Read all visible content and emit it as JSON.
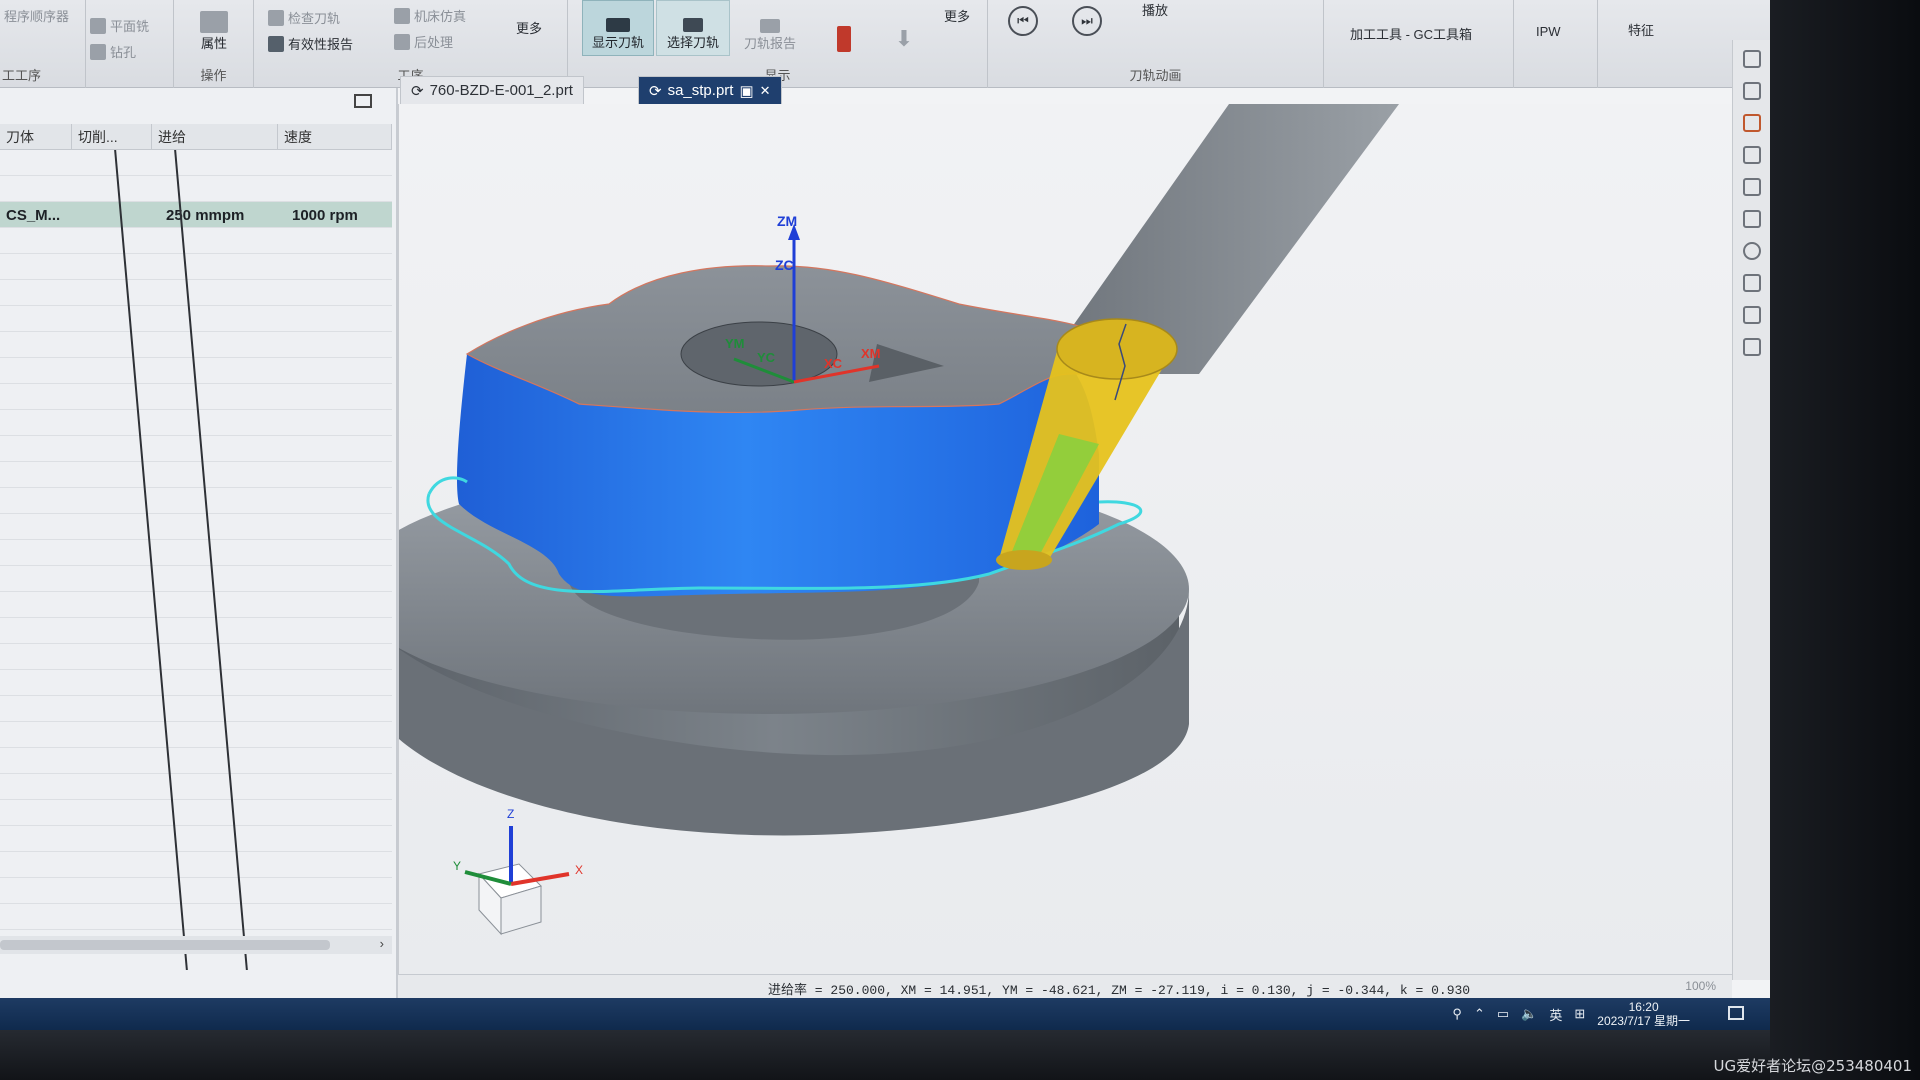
{
  "ribbon": {
    "group_op": {
      "items": [
        "平面铣",
        "钻孔",
        "检查刀轨",
        "有效性报告",
        "机床仿真",
        "后处理",
        "更多"
      ],
      "label_attr": "属性",
      "label_op": "操作",
      "label_proc": "工序",
      "left_item": "程序顺序器",
      "left_label": "工工序"
    },
    "group_display": {
      "show_path": "显示刀轨",
      "select_path": "选择刀轨",
      "path_report": "刀轨报告",
      "label": "显示"
    },
    "group_anim": {
      "more": "更多",
      "play": "播放",
      "label": "刀轨动画"
    },
    "group_tools": {
      "tool_lib": "加工工具 - GC工具箱",
      "ipw": "IPW",
      "feature": "特征"
    }
  },
  "navigator": {
    "columns": [
      "刀体",
      "切削...",
      "进给",
      "速度"
    ],
    "rows": [
      {
        "name": "",
        "cut": "",
        "feed": "",
        "speed": ""
      },
      {
        "name": "CS_M...",
        "cut": "",
        "feed": "250 mmpm",
        "speed": "1000 rpm"
      }
    ]
  },
  "tabs": [
    {
      "label": "760-BZD-E-001_2.prt",
      "active": false
    },
    {
      "label": "sa_stp.prt",
      "active": true
    }
  ],
  "viewport": {
    "csys": {
      "zm": "ZM",
      "zc": "ZC",
      "ym": "YM",
      "yc": "YC",
      "xc": "XC",
      "xm": "XM"
    },
    "triad": {
      "z": "Z",
      "y": "Y",
      "x": "X"
    }
  },
  "status": {
    "text": "进给率 = 250.000, XM = 14.951, YM = -48.621, ZM = -27.119, i = 0.130, j = -0.344, k = 0.930",
    "zoom": "100%"
  },
  "taskbar": {
    "ime": "英",
    "time": "16:20",
    "date": "2023/7/17 星期一"
  },
  "watermark": "UG爱好者论坛@253480401",
  "colors": {
    "part_blue": "#1f6fe6",
    "tool_yellow": "#e6c21c",
    "tool_green": "#8fcf3c",
    "path_cyan": "#3fd8e0",
    "tab_active": "#1f3f6e"
  }
}
